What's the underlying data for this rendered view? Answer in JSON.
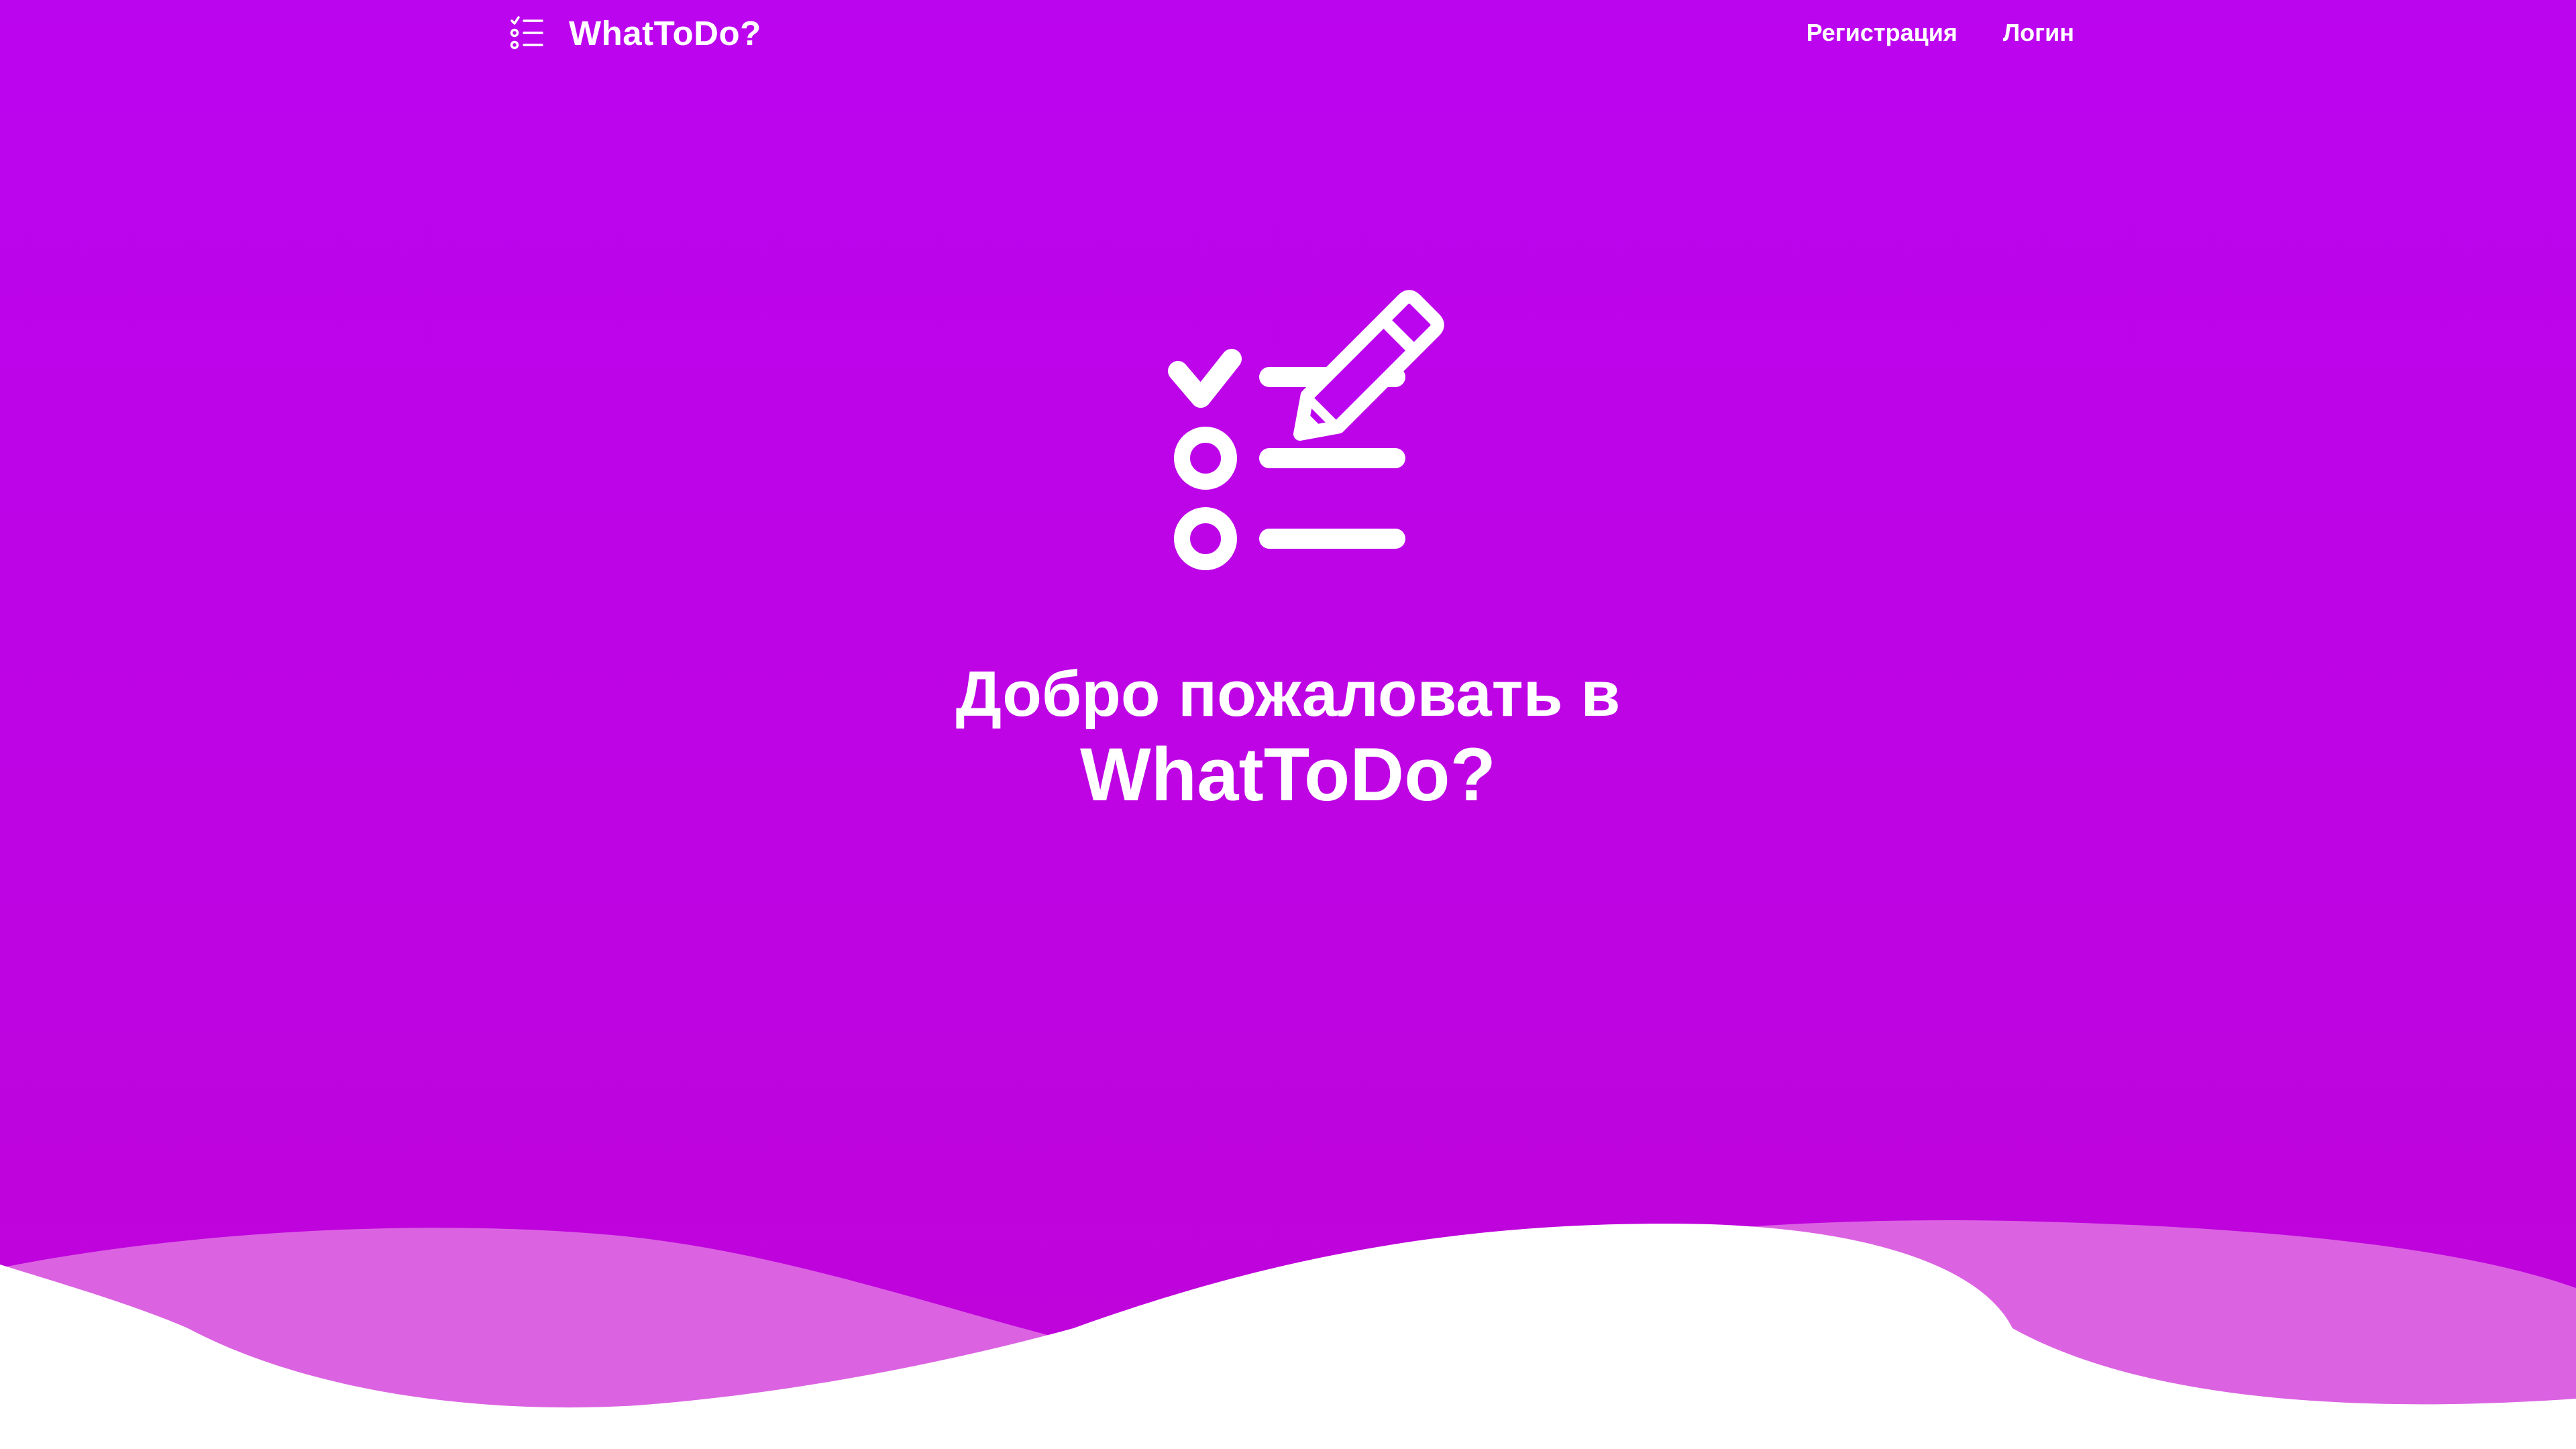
{
  "header": {
    "brand_name": "WhatToDo?",
    "brand_icon": "checklist-icon",
    "nav": {
      "register_label": "Регистрация",
      "login_label": "Логин"
    }
  },
  "hero": {
    "icon": "checklist-edit-icon",
    "title_line1": "Добро пожаловать в",
    "title_line2": "WhatToDo?"
  },
  "colors": {
    "background_top": "#bc05ef",
    "background_bottom": "#bf03d9",
    "wave_light": "#db63e2",
    "wave_white": "#ffffff",
    "text": "#ffffff"
  }
}
